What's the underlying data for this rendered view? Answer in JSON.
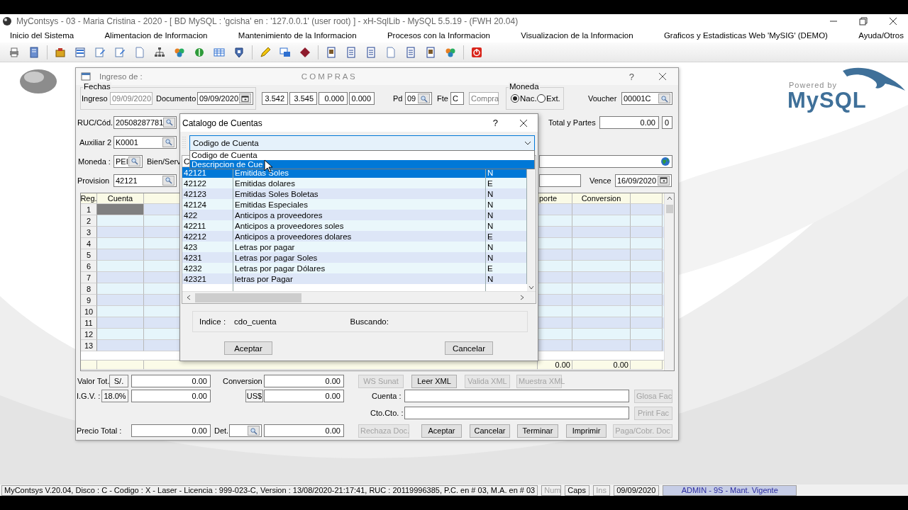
{
  "window": {
    "title": "MyContsys - 03 - Maria Cristina - 2020 - [ BD MySQL : 'gcisha' en : '127.0.0.1' (user root) ] - xH-SqlLib - MySQL 5.5.19 - (FWH 20.04)"
  },
  "menu": [
    "Inicio del Sistema",
    "Alimentacion de Informacion",
    "Mantenimiento de la Informacion",
    "Procesos con la Informacion",
    "Visualizacion de la Informacion",
    "Graficos y Estadisticas Web 'MySIG' (DEMO)",
    "Ayuda/Otros"
  ],
  "logo": {
    "tagline": "Powered by",
    "name": "MySQL"
  },
  "form": {
    "title": "Ingreso de :",
    "heading": "C O M P R A S",
    "help": "?",
    "fechas": {
      "legend": "Fechas",
      "ingreso_label": "Ingreso",
      "ingreso": "09/09/2020",
      "ingreso_disabled": true,
      "documento_label": "Documento",
      "documento": "09/09/2020"
    },
    "rates": [
      "3.542",
      "3.545",
      "0.000",
      "0.000"
    ],
    "pd_label": "Pd",
    "pd": "09",
    "fte_label": "Fte",
    "fte": "C",
    "tipo": "Compra",
    "tipo_disabled": true,
    "moneda_group": {
      "legend": "Moneda",
      "options": [
        {
          "label": "Nac.",
          "selected": true
        },
        {
          "label": "Ext.",
          "selected": false
        }
      ]
    },
    "voucher_label": "Voucher",
    "voucher": "00001C",
    "ruc_label": "RUC/Cód.",
    "ruc": "20508287781",
    "total_partes_label": "Total y Partes",
    "total_partes": "0.00",
    "partes_count": "0",
    "auxiliar_label": "Auxiliar 2",
    "auxiliar": "K0001",
    "moneda_label": "Moneda :",
    "moneda": "PEI",
    "bien_serv_label": "Bien/Serv",
    "provision_label": "Provision",
    "provision": "42121",
    "vence_label": "Vence",
    "vence": "16/09/2020",
    "grid": {
      "columns": [
        "Reg.",
        "Cuenta",
        "porte",
        "Conversion"
      ],
      "rows": [
        {
          "reg": "1",
          "selected": true
        },
        {
          "reg": "2",
          "selected": false
        },
        {
          "reg": "3",
          "selected": false
        },
        {
          "reg": "4",
          "selected": false
        },
        {
          "reg": "5",
          "selected": false
        },
        {
          "reg": "6",
          "selected": false
        },
        {
          "reg": "7",
          "selected": false
        },
        {
          "reg": "8",
          "selected": false
        },
        {
          "reg": "9",
          "selected": false
        },
        {
          "reg": "10",
          "selected": false
        },
        {
          "reg": "11",
          "selected": false
        },
        {
          "reg": "12",
          "selected": false
        },
        {
          "reg": "13",
          "selected": false
        }
      ],
      "totals": [
        "0.00",
        "0.00"
      ]
    },
    "valor_tot_label": "Valor Tot.",
    "currency": "S/.",
    "valor_tot": "0.00",
    "conversion_label": "Conversion",
    "conversion": "0.00",
    "igv_label": "I.G.V. :",
    "igv_rate": "18.0%",
    "igv": "0.00",
    "usd": "US$",
    "usd_value": "0.00",
    "precio_label": "Precio Total :",
    "precio": "0.00",
    "det_label": "Det.",
    "det_value": "0.00",
    "cuenta_label": "Cuenta :",
    "cto_label": "Cto.Cto. :",
    "xml_buttons": [
      {
        "label": "WS Sunat",
        "disabled": true
      },
      {
        "label": "Leer XML",
        "disabled": false
      },
      {
        "label": "Valida XML",
        "disabled": true
      },
      {
        "label": "Muestra XML",
        "disabled": true
      }
    ],
    "side_buttons": [
      {
        "label": "Glosa Fac",
        "disabled": true
      },
      {
        "label": "Print Fac",
        "disabled": true
      }
    ],
    "action_buttons": [
      {
        "label": "Rechaza Doc.",
        "disabled": true
      },
      {
        "label": "Aceptar",
        "disabled": false
      },
      {
        "label": "Cancelar",
        "disabled": false
      },
      {
        "label": "Terminar",
        "disabled": false
      },
      {
        "label": "Imprimir",
        "disabled": false
      },
      {
        "label": "Paga/Cobr. Doc",
        "disabled": true
      }
    ]
  },
  "dialog": {
    "title": "Catalogo de Cuentas",
    "help": "?",
    "combo": "Codigo de Cuenta",
    "options": [
      {
        "label": "Codigo de Cuenta",
        "selected": false
      },
      {
        "label": "Descripcion de Cue",
        "selected": true
      }
    ],
    "header_fragment": "C",
    "rows": [
      {
        "code": "42121",
        "description": "Emitidas Soles",
        "currency": "N",
        "selected": true
      },
      {
        "code": "42122",
        "description": "Emitidas dolares",
        "currency": "E",
        "selected": false
      },
      {
        "code": "42123",
        "description": "Emitidas Soles Boletas",
        "currency": "N",
        "selected": false
      },
      {
        "code": "42124",
        "description": "Emitidas Especiales",
        "currency": "N",
        "selected": false
      },
      {
        "code": "422",
        "description": "Anticipos a proveedores",
        "currency": "N",
        "selected": false
      },
      {
        "code": "42211",
        "description": "Anticipos a proveedores soles",
        "currency": "N",
        "selected": false
      },
      {
        "code": "42212",
        "description": "Anticipos a proveedores dolares",
        "currency": "E",
        "selected": false
      },
      {
        "code": "423",
        "description": "Letras por pagar",
        "currency": "N",
        "selected": false
      },
      {
        "code": "4231",
        "description": "Letras por pagar Soles",
        "currency": "N",
        "selected": false
      },
      {
        "code": "4232",
        "description": "Letras por pagar Dólares",
        "currency": "E",
        "selected": false
      },
      {
        "code": "42321",
        "description": "letras por Pagar",
        "currency": "N",
        "selected": false
      }
    ],
    "indice_label": "Indice :",
    "indice": "cdo_cuenta",
    "buscando_label": "Buscando:",
    "buttons": [
      "Aceptar",
      "Cancelar"
    ]
  },
  "status_bar": {
    "info": "MyContsys V.20.04, Disco : C - Codigo : X - Laser - Licencia : 999-023-C, Version : 13/08/2020-21:17:41, RUC : 20119996385, P.C. en # 03, M.A. en # 03",
    "indicators": [
      {
        "label": "Num",
        "on": false
      },
      {
        "label": "Caps",
        "on": true
      },
      {
        "label": "Ins",
        "on": false
      }
    ],
    "date": "09/09/2020",
    "user": "ADMIN - 9S - Mant. Vigente"
  }
}
